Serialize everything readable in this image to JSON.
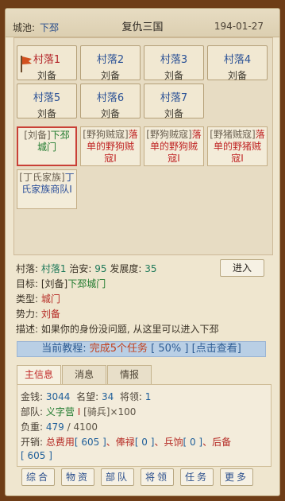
{
  "header": {
    "city_label": "城池:",
    "city_value": "下邳",
    "game_title": "复仇三国",
    "date": "194-01-27"
  },
  "villages": [
    {
      "name": "村落1",
      "owner": "刘备"
    },
    {
      "name": "村落2",
      "owner": "刘备"
    },
    {
      "name": "村落3",
      "owner": "刘备"
    },
    {
      "name": "村落4",
      "owner": "刘备"
    },
    {
      "name": "村落5",
      "owner": "刘备"
    },
    {
      "name": "村落6",
      "owner": "刘备"
    },
    {
      "name": "村落7",
      "owner": "刘备"
    }
  ],
  "npcs": [
    {
      "tag": "[刘备]",
      "text": "下邳城门"
    },
    {
      "tag": "[野狗贼寇]",
      "text": "落单的野狗贼寇Ⅰ"
    },
    {
      "tag": "[野狗贼寇]",
      "text": "落单的野狗贼寇Ⅰ"
    },
    {
      "tag": "[野猪贼寇]",
      "text": "落单的野猪贼寇Ⅰ"
    },
    {
      "tag": "[丁氏家族]",
      "text": "丁氏家族商队Ⅰ"
    }
  ],
  "detail": {
    "village_label": "村落:",
    "village_value": "村落1",
    "security_label": "治安:",
    "security_value": "95",
    "development_label": "发展度:",
    "development_value": "35",
    "target_label": "目标:",
    "target_tag": "[刘备]",
    "target_value": "下邳城门",
    "type_label": "类型:",
    "type_value": "城门",
    "faction_label": "势力:",
    "faction_value": "刘备",
    "desc_label": "描述:",
    "desc_value": "如果你的身份没问题, 从这里可以进入下邳",
    "enter_button": "进入"
  },
  "tutorial": {
    "prefix": "当前教程:",
    "task": "完成5个任务",
    "progress": "[ 50% ]",
    "view": "[点击查看]"
  },
  "tabs": [
    "主信息",
    "消息",
    "情报"
  ],
  "stats": {
    "gold_label": "金钱:",
    "gold": "3044",
    "fame_label": "名望:",
    "fame": "34",
    "general_label": "将领:",
    "general": "1",
    "troop_label": "部队:",
    "troop_name": "义字营",
    "troop_level": "Ⅰ",
    "troop_type": "[骑兵]×100",
    "load_label": "负重:",
    "load_current": "479",
    "load_sep": "/",
    "load_max": "4100",
    "cost_label": "开销:",
    "cost_total_label": "总费用",
    "cost_total": "[ 605 ]",
    "cost_salary_label": "、俸禄",
    "cost_salary": "[ 0 ]",
    "cost_pay_label": "、兵饷",
    "cost_pay": "[ 0 ]",
    "cost_supply_label": "、后备",
    "cost_supply": "[ 605 ]"
  },
  "bottom_buttons": [
    "综合",
    "物资",
    "部队",
    "将领",
    "任务",
    "更多"
  ],
  "colors": {
    "background": "#6e3d17",
    "frame": "#efe6cf",
    "link_blue": "#2a4e8c",
    "alert_red": "#c02626",
    "friendly_green": "#1f7a2d",
    "tutorial_bar": "#b9cfe5"
  }
}
